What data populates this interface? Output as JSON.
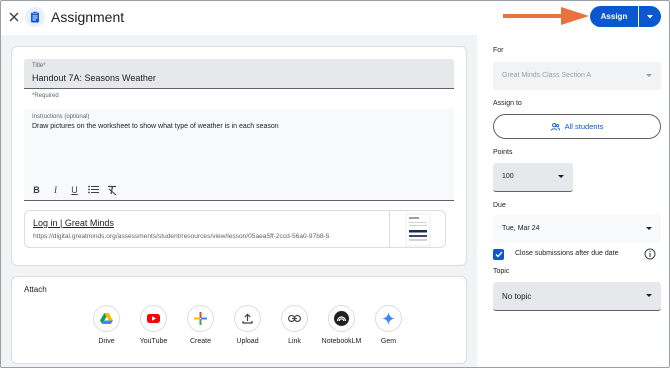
{
  "header": {
    "title": "Assignment",
    "assign_label": "Assign"
  },
  "colors": {
    "primary": "#0b57d0",
    "arrow": "#e8713d"
  },
  "form": {
    "title_label": "Title*",
    "title_value": "Handout 7A: Seasons Weather",
    "required_note": "*Required",
    "instructions_label": "Instructions (optional)",
    "instructions_value": "Draw pictures on the worksheet to show what type of weather is in each season",
    "formatting": [
      "bold-icon",
      "italic-icon",
      "underline-icon",
      "bulleted-list-icon",
      "clear-formatting-icon"
    ]
  },
  "attachment": {
    "title": "Log in | Great Minds",
    "url": "https://digital.greatminds.org/assessments/student/resources/view/lesson/05aea5ff-2ccd-56a0-97b8-5"
  },
  "attach": {
    "title": "Attach",
    "items": [
      {
        "label": "Drive",
        "icon": "google-drive-icon"
      },
      {
        "label": "YouTube",
        "icon": "youtube-icon"
      },
      {
        "label": "Create",
        "icon": "plus-icon"
      },
      {
        "label": "Upload",
        "icon": "upload-icon"
      },
      {
        "label": "Link",
        "icon": "link-icon"
      },
      {
        "label": "NotebookLM",
        "icon": "notebooklm-icon"
      },
      {
        "label": "Gem",
        "icon": "gem-icon"
      }
    ]
  },
  "sidebar": {
    "for_label": "For",
    "for_value": "Great Minds Class Section A",
    "assign_to_label": "Assign to",
    "assign_to_value": "All students",
    "points_label": "Points",
    "points_value": "100",
    "due_label": "Due",
    "due_value": "Tue, Mar 24",
    "close_submissions_label": "Close submissions after due date",
    "close_submissions_checked": true,
    "topic_label": "Topic",
    "topic_value": "No topic"
  }
}
